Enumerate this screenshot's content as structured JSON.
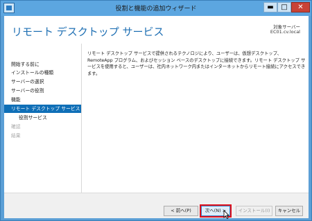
{
  "window": {
    "title": "役割と機能の追加ウィザード",
    "minimize_glyph": "▬",
    "maximize_glyph": "□",
    "close_glyph": "✕"
  },
  "header": {
    "page_title": "リモート デスクトップ サービス",
    "target_label": "対象サーバー",
    "target_server": "EC01.cv.local"
  },
  "nav": {
    "items": [
      {
        "label": "開始する前に",
        "state": "normal"
      },
      {
        "label": "インストールの種類",
        "state": "normal"
      },
      {
        "label": "サーバーの選択",
        "state": "normal"
      },
      {
        "label": "サーバーの役割",
        "state": "normal"
      },
      {
        "label": "機能",
        "state": "normal"
      },
      {
        "label": "リモート デスクトップ サービス",
        "state": "active"
      },
      {
        "label": "役割サービス",
        "state": "sub"
      },
      {
        "label": "確認",
        "state": "disabled"
      },
      {
        "label": "結果",
        "state": "disabled"
      }
    ]
  },
  "content": {
    "description": "リモート デスクトップ サービスで提供されるテクノロジにより、ユーザーは、仮想デスクトップ、RemoteApp プログラム、およびセッション ベースのデスクトップに接続できます。リモート デスクトップ サービスを使用すると、ユーザーは、社内ネットワーク内またはインターネットからリモート接続にアクセスできます。"
  },
  "footer": {
    "prev_label": "< 前へ(P)",
    "next_label": "次へ(N) >",
    "install_label": "インストール(I)",
    "cancel_label": "キャンセル"
  },
  "colors": {
    "accent": "#0f6fb7",
    "title_blue": "#1e6fb3",
    "highlight_red": "#e0101b"
  }
}
